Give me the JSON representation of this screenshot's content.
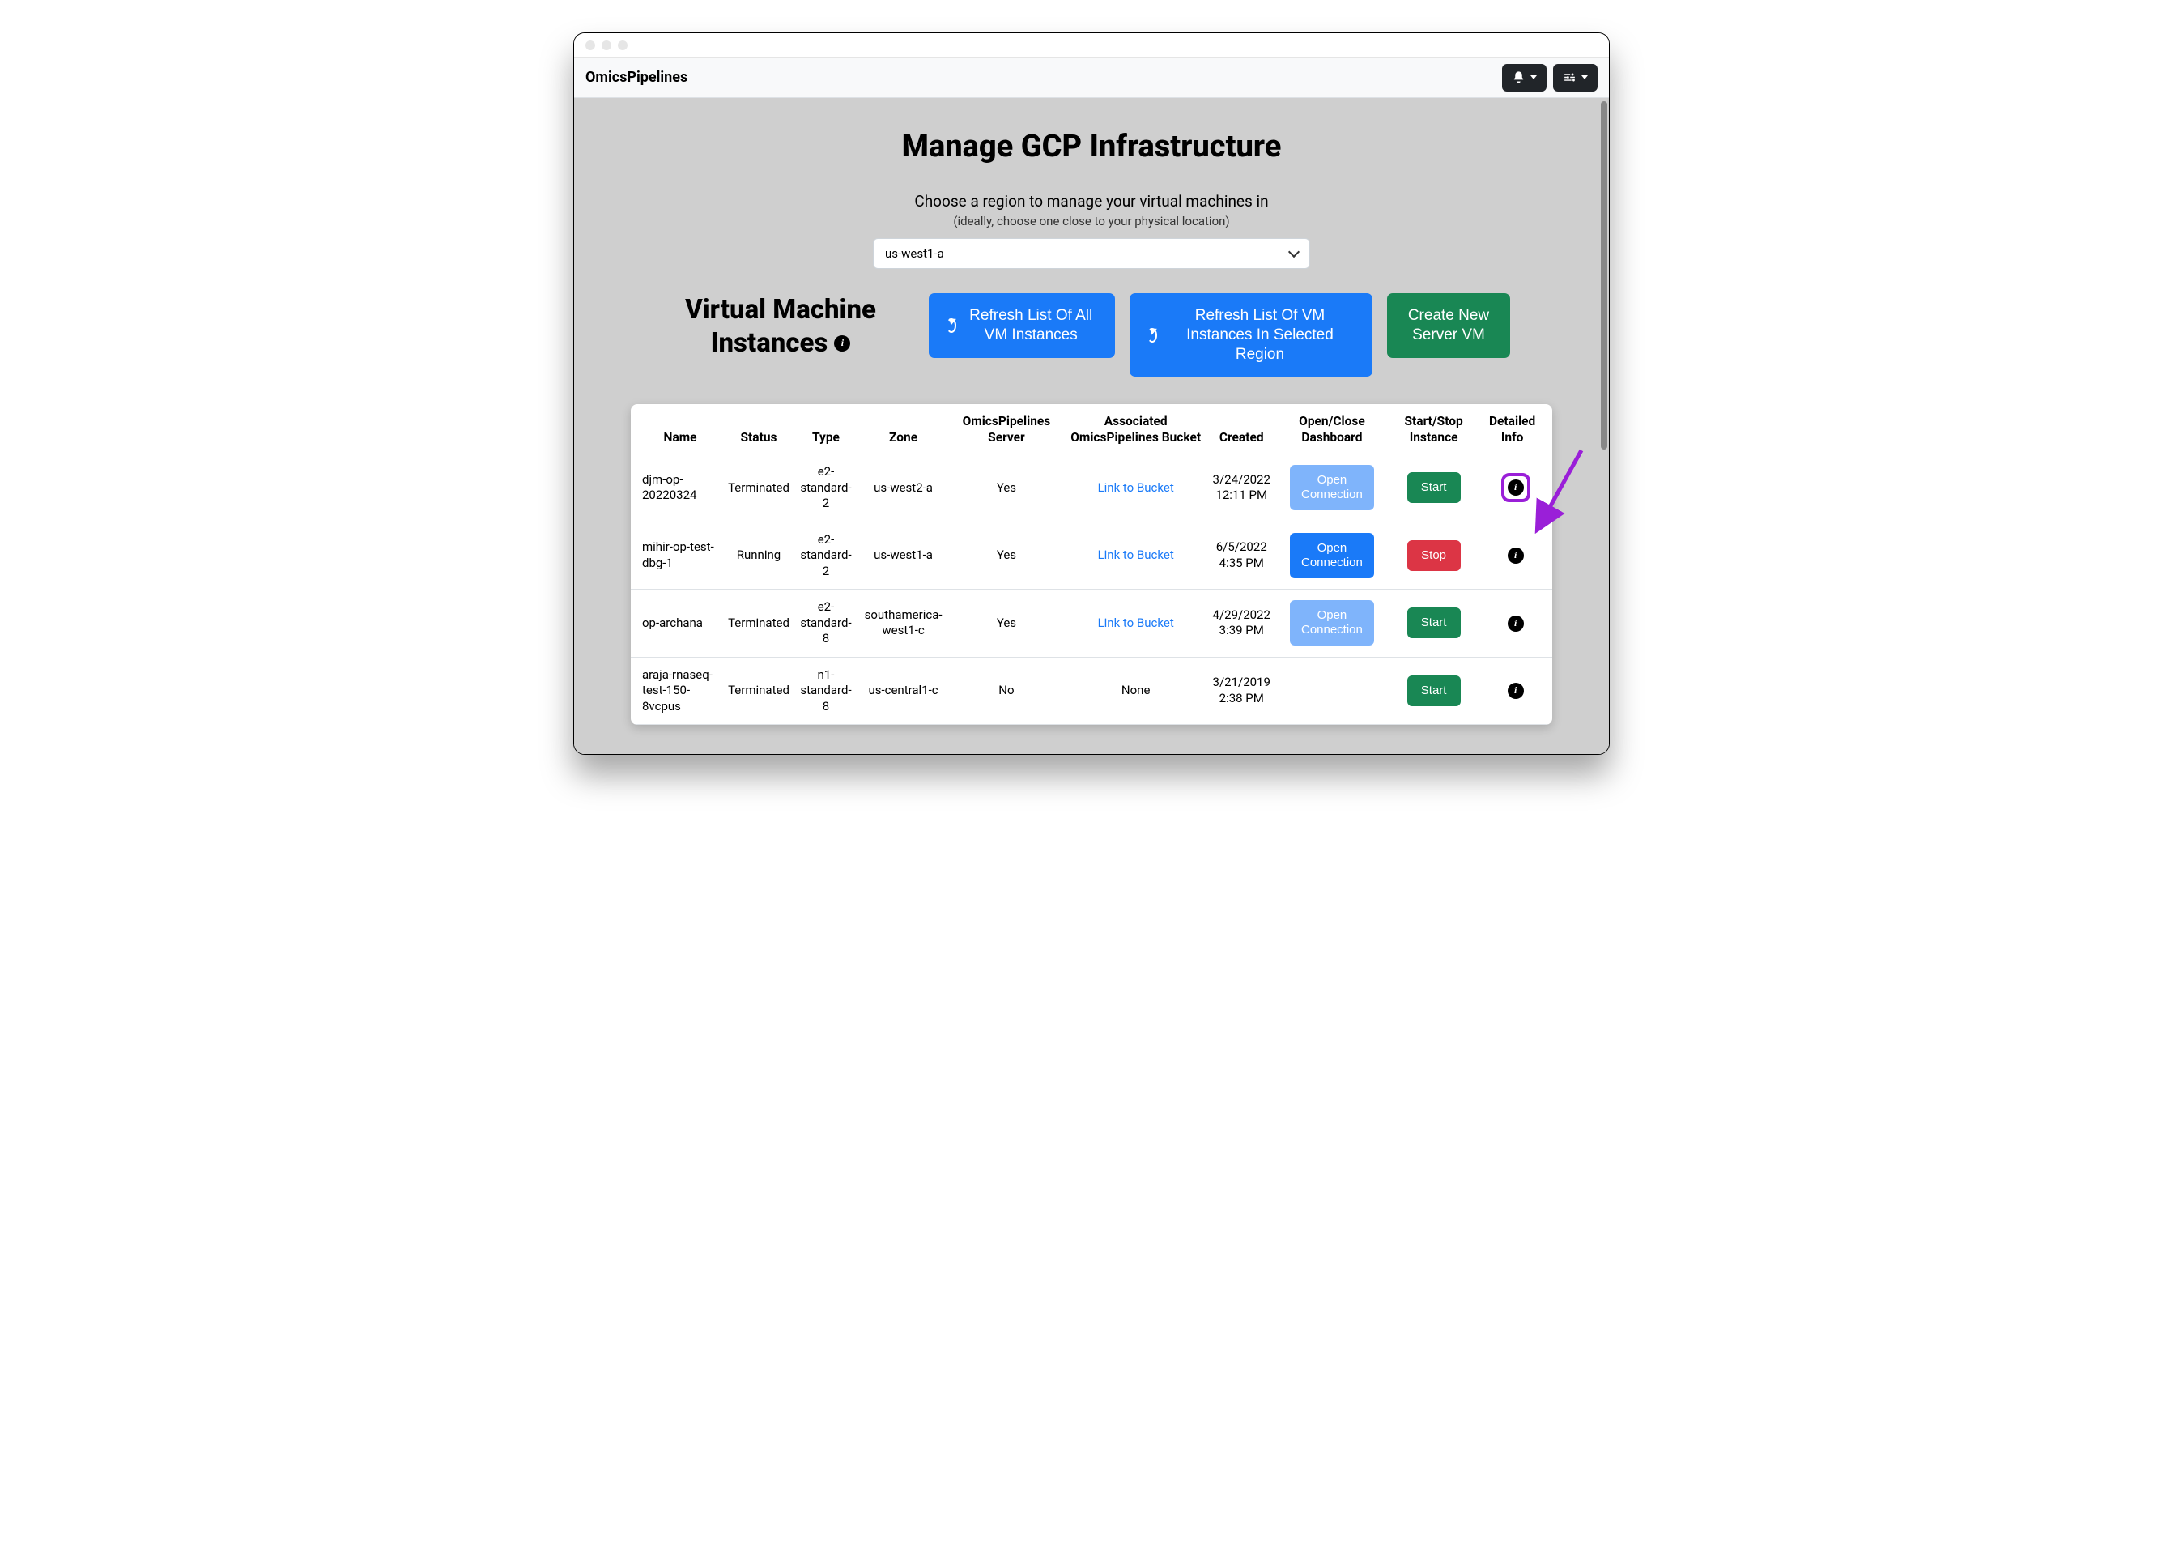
{
  "brand": "OmicsPipelines",
  "page_title": "Manage GCP Infrastructure",
  "help_line": "Choose a region to manage your virtual machines in",
  "help_sub": "(ideally, choose one close to your physical location)",
  "region_selected": "us-west1-a",
  "section_heading_line1": "Virtual Machine",
  "section_heading_line2": "Instances",
  "buttons": {
    "refresh_all": "Refresh List Of All VM Instances",
    "refresh_region": "Refresh List Of VM Instances In Selected Region",
    "create_vm": "Create New Server VM"
  },
  "columns": {
    "name": "Name",
    "status": "Status",
    "type": "Type",
    "zone": "Zone",
    "server": "OmicsPipelines Server",
    "bucket": "Associated OmicsPipelines Bucket",
    "created": "Created",
    "dashboard": "Open/Close Dashboard",
    "startstop": "Start/Stop Instance",
    "info": "Detailed Info"
  },
  "cell_labels": {
    "open_connection": "Open Connection",
    "start": "Start",
    "stop": "Stop",
    "link_to_bucket": "Link to Bucket",
    "none": "None"
  },
  "rows": [
    {
      "name": "djm-op-20220324",
      "status": "Terminated",
      "type": "e2-standard-2",
      "zone": "us-west2-a",
      "server": "Yes",
      "bucket_link": true,
      "created_date": "3/24/2022",
      "created_time": "12:11 PM",
      "connection_enabled": false,
      "action": "Start",
      "highlighted": true
    },
    {
      "name": "mihir-op-test-dbg-1",
      "status": "Running",
      "type": "e2-standard-2",
      "zone": "us-west1-a",
      "server": "Yes",
      "bucket_link": true,
      "created_date": "6/5/2022",
      "created_time": "4:35 PM",
      "connection_enabled": true,
      "action": "Stop",
      "highlighted": false
    },
    {
      "name": "op-archana",
      "status": "Terminated",
      "type": "e2-standard-8",
      "zone": "southamerica-west1-c",
      "server": "Yes",
      "bucket_link": true,
      "created_date": "4/29/2022",
      "created_time": "3:39 PM",
      "connection_enabled": false,
      "action": "Start",
      "highlighted": false
    },
    {
      "name": "araja-rnaseq-test-150-8vcpus",
      "status": "Terminated",
      "type": "n1-standard-8",
      "zone": "us-central1-c",
      "server": "No",
      "bucket_link": false,
      "created_date": "3/21/2019",
      "created_time": "2:38 PM",
      "connection_enabled": null,
      "action": "Start",
      "highlighted": false
    }
  ]
}
